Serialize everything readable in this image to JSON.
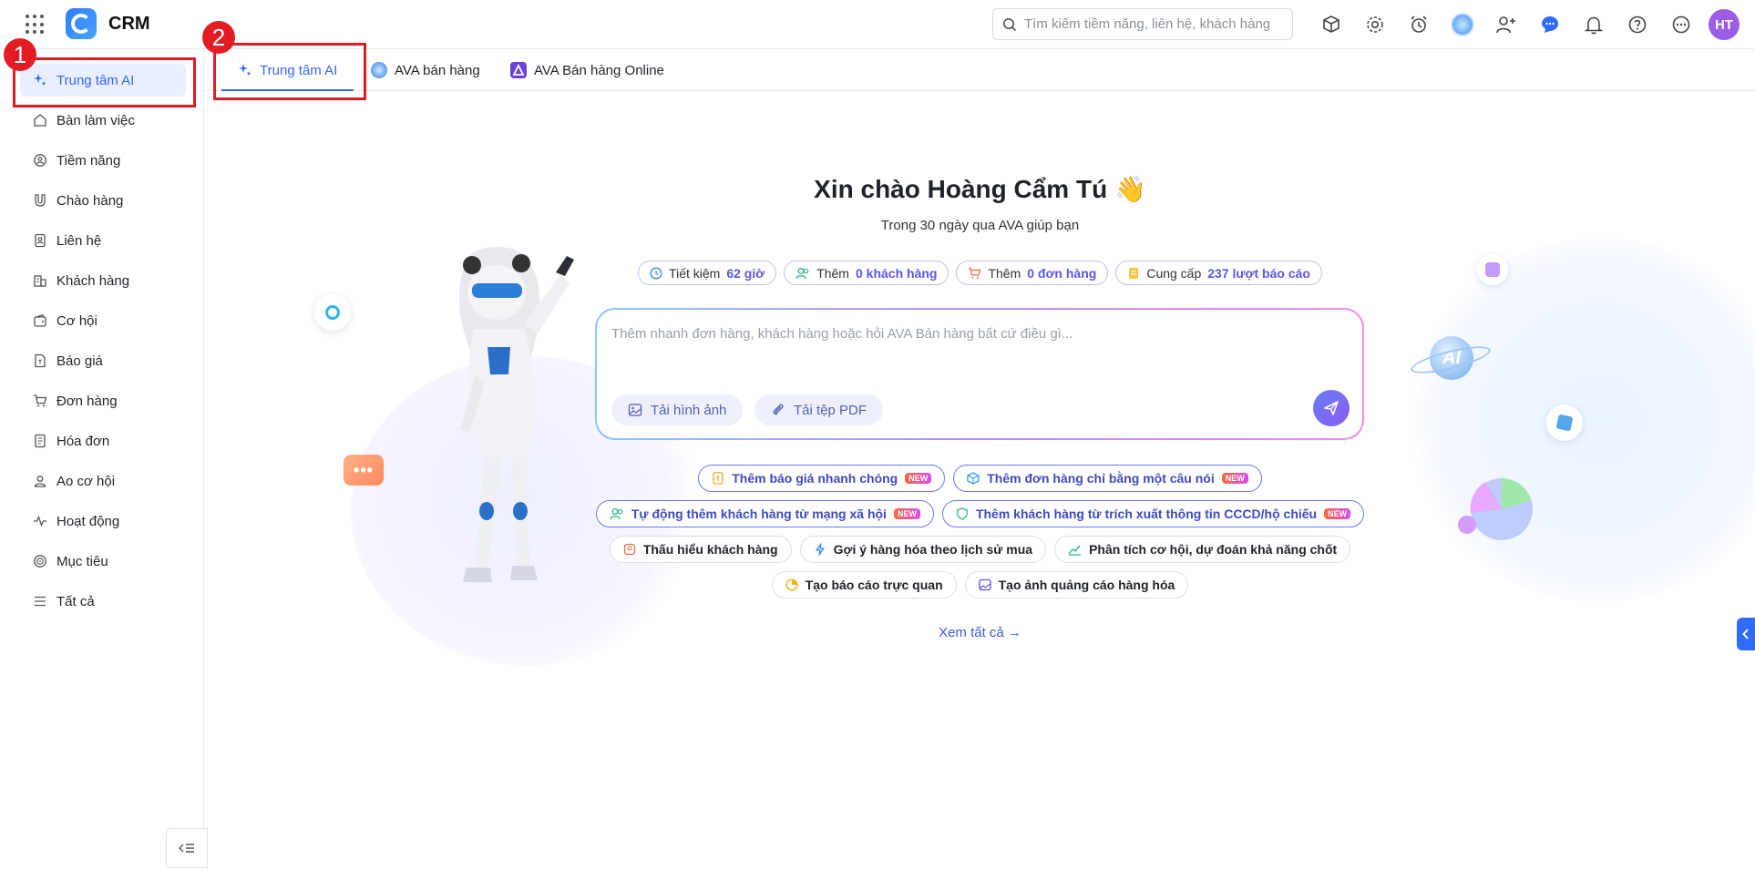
{
  "app": {
    "name": "CRM"
  },
  "search": {
    "placeholder": "Tìm kiếm tiềm năng, liên hệ, khách hàng"
  },
  "user": {
    "initials": "HT"
  },
  "colors": {
    "accent": "#3366ff",
    "callout": "#e31b23",
    "avatar": "#9b5de5"
  },
  "sidebar": {
    "items": [
      {
        "label": "Trung tâm AI",
        "icon": "sparkle-icon",
        "active": true
      },
      {
        "label": "Bàn làm việc",
        "icon": "home-icon"
      },
      {
        "label": "Tiềm năng",
        "icon": "target-user-icon"
      },
      {
        "label": "Chào hàng",
        "icon": "magnet-icon"
      },
      {
        "label": "Liên hệ",
        "icon": "contact-book-icon"
      },
      {
        "label": "Khách hàng",
        "icon": "building-icon"
      },
      {
        "label": "Cơ hội",
        "icon": "wallet-icon"
      },
      {
        "label": "Báo giá",
        "icon": "quote-doc-icon"
      },
      {
        "label": "Đơn hàng",
        "icon": "cart-icon"
      },
      {
        "label": "Hóa đơn",
        "icon": "invoice-icon"
      },
      {
        "label": "Ao cơ hội",
        "icon": "pool-icon"
      },
      {
        "label": "Hoạt động",
        "icon": "activity-icon"
      },
      {
        "label": "Mục tiêu",
        "icon": "goal-icon"
      },
      {
        "label": "Tất cả",
        "icon": "menu-icon"
      }
    ]
  },
  "tabs": [
    {
      "label": "Trung tâm AI",
      "active": true
    },
    {
      "label": "AVA bán hàng"
    },
    {
      "label": "AVA Bán hàng Online"
    }
  ],
  "callouts": [
    "1",
    "2"
  ],
  "hero": {
    "greeting": "Xin chào Hoàng Cẩm Tú 👋",
    "subtitle": "Trong 30 ngày qua AVA giúp bạn"
  },
  "stats": [
    {
      "prefix": "Tiết kiệm",
      "value": "62 giờ"
    },
    {
      "prefix": "Thêm",
      "value": "0 khách hàng"
    },
    {
      "prefix": "Thêm",
      "value": "0 đơn hàng"
    },
    {
      "prefix": "Cung cấp",
      "value": "237 lượt báo cáo"
    }
  ],
  "prompt": {
    "placeholder": "Thêm nhanh đơn hàng, khách hàng hoặc hỏi AVA Bán hàng bất cứ điều gì...",
    "upload_image": "Tải hình ảnh",
    "upload_pdf": "Tải tệp PDF"
  },
  "suggestions": {
    "badge": "NEW",
    "row1": [
      "Thêm báo giá nhanh chóng",
      "Thêm đơn hàng chỉ bằng một câu nói"
    ],
    "row2": [
      "Tự động thêm khách hàng từ mạng xã hội",
      "Thêm khách hàng từ trích xuất thông tin CCCD/hộ chiếu"
    ],
    "row3": [
      "Thấu hiểu khách hàng",
      "Gợi ý hàng hóa theo lịch sử mua",
      "Phân tích cơ hội, dự đoán khả năng chốt"
    ],
    "row4": [
      "Tạo báo cáo trực quan",
      "Tạo ảnh quảng cáo hàng hóa"
    ]
  },
  "see_all": "Xem tất cả →"
}
